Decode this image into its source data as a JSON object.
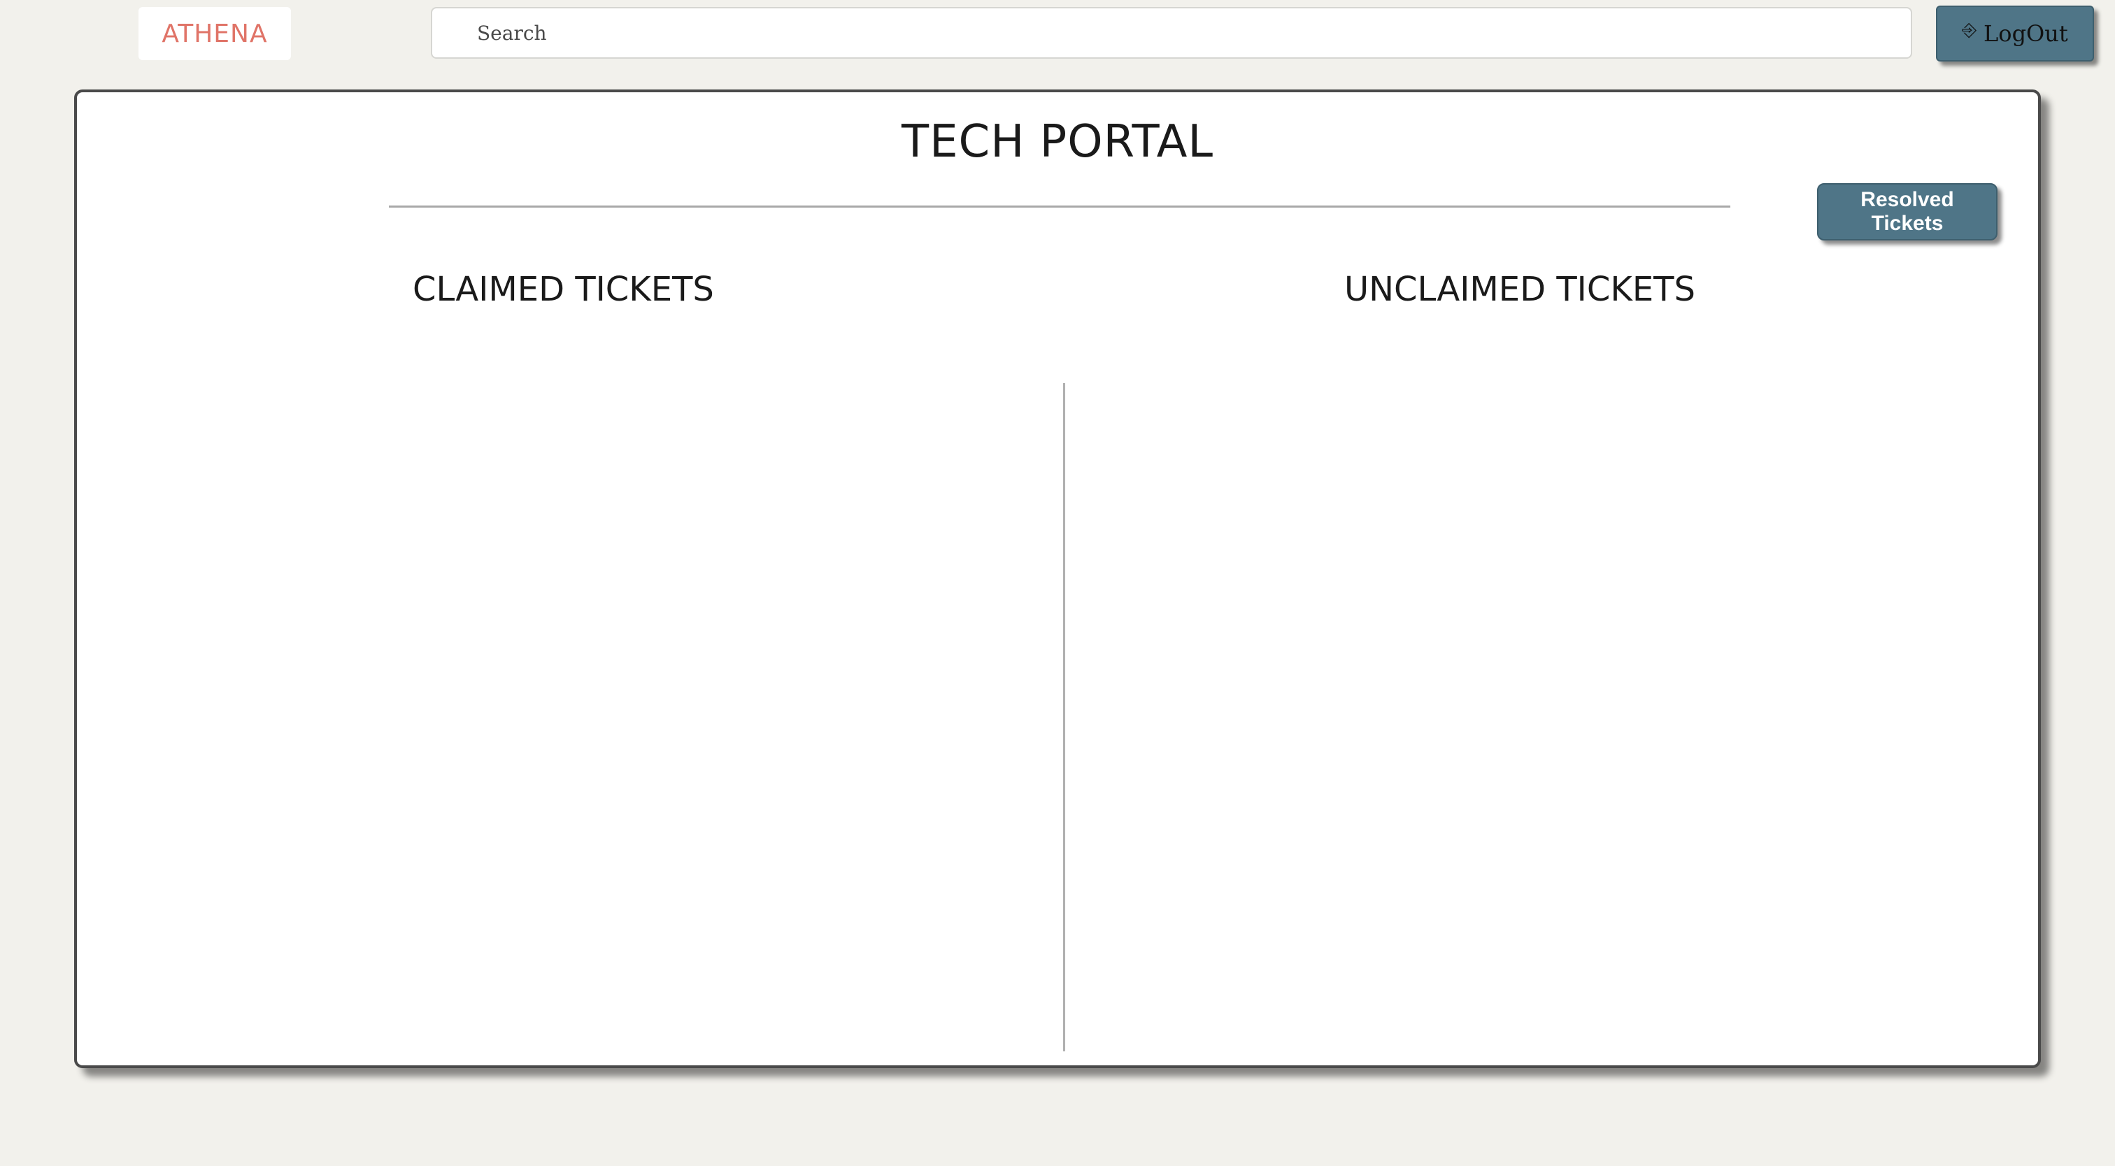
{
  "header": {
    "brand": "ATHENA",
    "search_placeholder": "Search",
    "logout_label": "LogOut",
    "logout_icon": "logout-icon"
  },
  "portal": {
    "title": "TECH PORTAL",
    "resolved_button_label": "Resolved Tickets",
    "claimed_heading": "CLAIMED TICKETS",
    "unclaimed_heading": "UNCLAIMED TICKETS",
    "claimed_tickets": [],
    "unclaimed_tickets": []
  },
  "colors": {
    "background": "#f2f1ec",
    "brand": "#e07468",
    "button": "#4f7587"
  }
}
